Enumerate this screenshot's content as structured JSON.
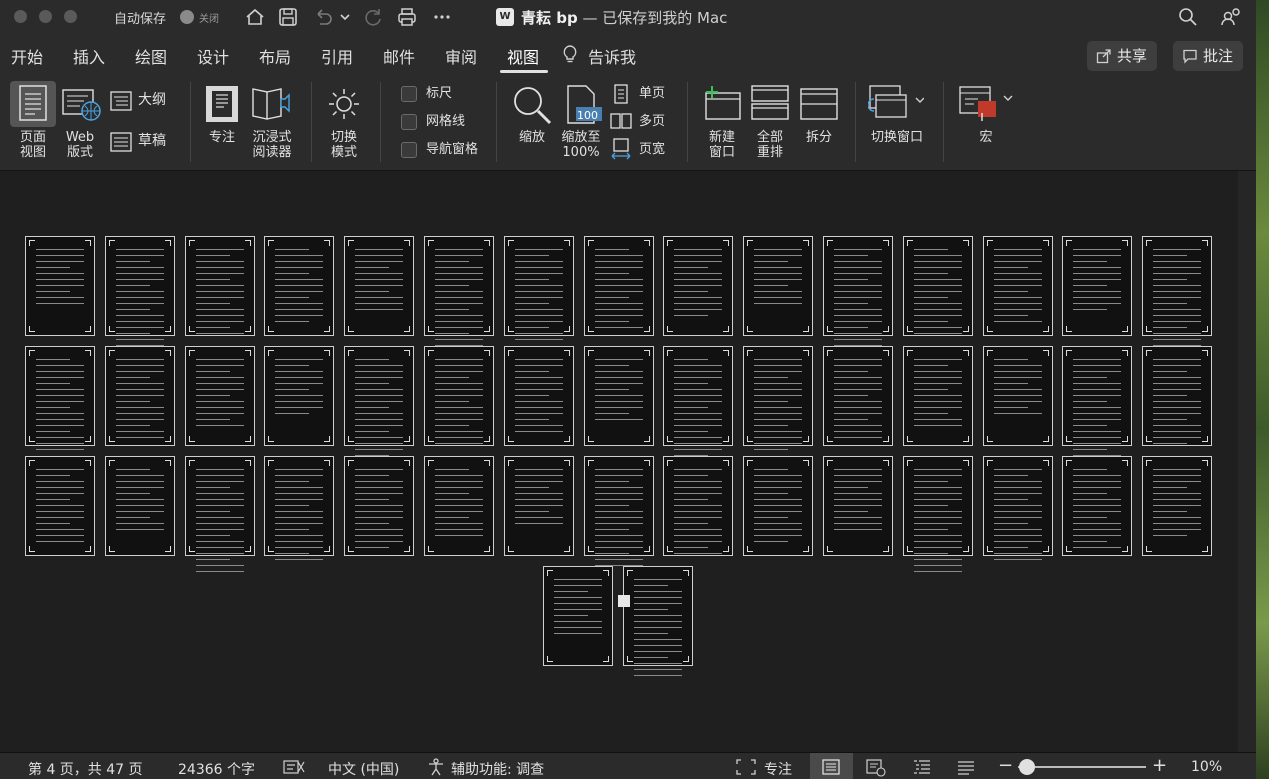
{
  "titlebar": {
    "autosave_label": "自动保存",
    "autosave_state": "关闭",
    "doc_name": "青耘 bp",
    "doc_status": " — 已保存到我的 Mac",
    "icons": [
      "home-icon",
      "save-icon",
      "undo-icon",
      "redo-icon",
      "print-icon",
      "more-icon",
      "search-icon",
      "share-people-icon"
    ]
  },
  "tabs": {
    "items": [
      "开始",
      "插入",
      "绘图",
      "设计",
      "布局",
      "引用",
      "邮件",
      "审阅",
      "视图",
      "告诉我"
    ],
    "active": "视图",
    "share_label": "共享",
    "comments_label": "批注"
  },
  "ribbon": {
    "views": {
      "print_layout": "页面\n视图",
      "web_layout": "Web\n版式",
      "outline": "大纲",
      "draft": "草稿"
    },
    "immersive": {
      "focus": "专注",
      "immersive_reader": "沉浸式\n阅读器"
    },
    "switch_mode": "切换\n模式",
    "show": {
      "ruler": "标尺",
      "gridlines": "网格线",
      "nav_pane": "导航窗格"
    },
    "zoom": {
      "zoom": "缩放",
      "zoom_100": "缩放至\n100%",
      "one_page": "单页",
      "multiple_pages": "多页",
      "page_width": "页宽",
      "badge_100": "100"
    },
    "window": {
      "new_window": "新建\n窗口",
      "arrange_all": "全部\n重排",
      "split": "拆分",
      "switch_windows": "切换窗口"
    },
    "macros": "宏"
  },
  "status": {
    "page": "第 4 页，共 47 页",
    "words": "24366 个字",
    "language": "中文 (中国)",
    "accessibility": "辅助功能: 调查",
    "focus": "专注",
    "zoom_minus": "−",
    "zoom_plus": "+",
    "zoom_level": "10%"
  },
  "colors": {
    "window_bg": "#1f1f1f",
    "chrome_bg": "#2b2b2b",
    "page_bg": "#111111",
    "page_border": "#cfcfcf"
  },
  "document": {
    "total_pages": 47
  }
}
